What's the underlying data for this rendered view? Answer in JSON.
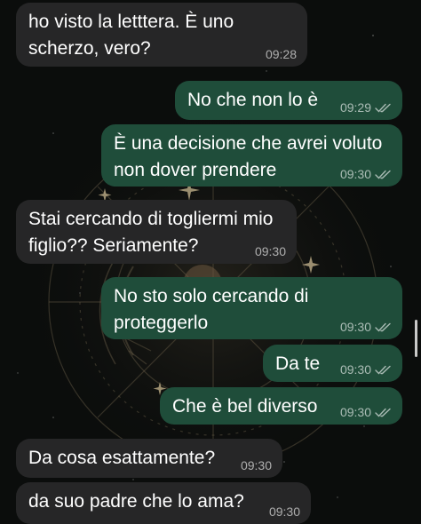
{
  "conversation": {
    "messages": [
      {
        "text": "ho visto la letttera. È uno\nscherzo, vero?",
        "time": "09:28",
        "direction": "incoming"
      },
      {
        "text": "No che non lo è",
        "time": "09:29",
        "direction": "outgoing",
        "status": "read"
      },
      {
        "text": "È una decisione che avrei voluto\nnon dover prendere",
        "time": "09:30",
        "direction": "outgoing",
        "status": "read"
      },
      {
        "text": "Stai cercando di togliermi mio\nfiglio?? Seriamente?",
        "time": "09:30",
        "direction": "incoming"
      },
      {
        "text": "No sto solo cercando di\nproteggerlo",
        "time": "09:30",
        "direction": "outgoing",
        "status": "read"
      },
      {
        "text": "Da te",
        "time": "09:30",
        "direction": "outgoing",
        "status": "read"
      },
      {
        "text": "Che è bel diverso",
        "time": "09:30",
        "direction": "outgoing",
        "status": "read"
      },
      {
        "text": "Da cosa esattamente?",
        "time": "09:30",
        "direction": "incoming"
      },
      {
        "text": "da suo padre che lo ama?",
        "time": "09:30",
        "direction": "incoming"
      }
    ]
  },
  "theme": {
    "incoming_bubble": "#262627",
    "outgoing_bubble": "#1f4d3a",
    "read_receipt_icon": "double-check-icon"
  }
}
